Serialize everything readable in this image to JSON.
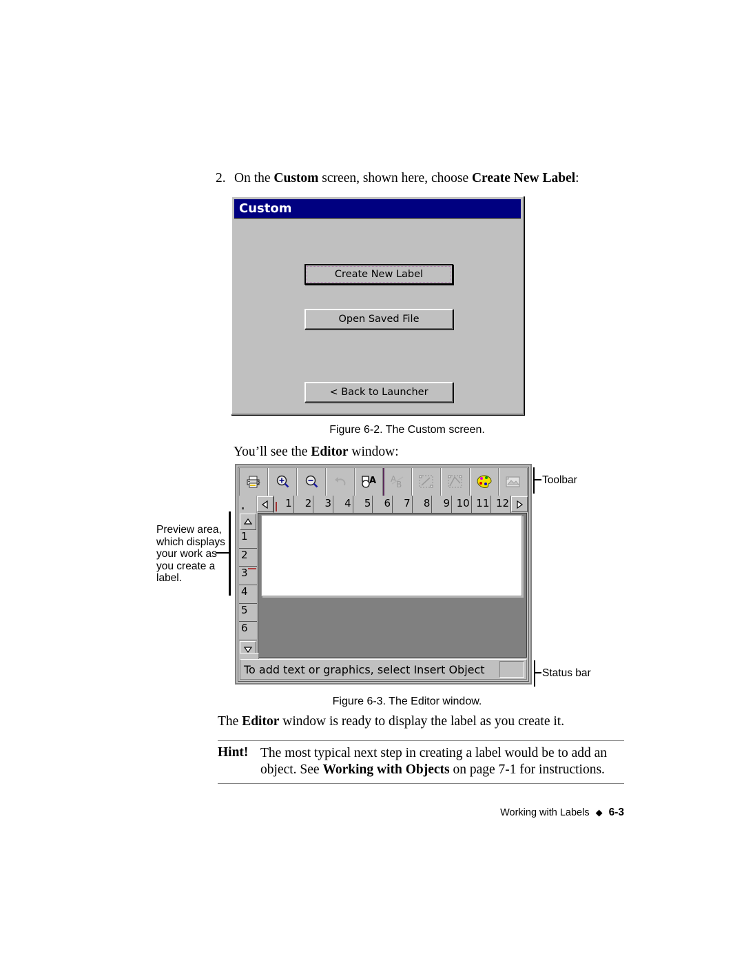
{
  "step": {
    "number": "2.",
    "before_bold1": "On the ",
    "bold1": "Custom",
    "middle": " screen, shown here, choose ",
    "bold2": "Create New Label",
    "after": ":"
  },
  "custom_dialog": {
    "title": "Custom",
    "buttons": [
      {
        "label": "Create New Label",
        "focused": true
      },
      {
        "label": "Open Saved File",
        "focused": false
      },
      {
        "label": "< Back to Launcher",
        "focused": false
      }
    ]
  },
  "figure_2_caption": "Figure 6-2. The Custom screen.",
  "lead_line": {
    "before": "You’ll see the ",
    "bold": "Editor",
    "after": " window:"
  },
  "editor_window": {
    "toolbar": [
      {
        "name": "print-icon",
        "label": "Print",
        "enabled": true
      },
      {
        "name": "zoom-in-icon",
        "label": "Zoom In",
        "enabled": true
      },
      {
        "name": "zoom-out-icon",
        "label": "Zoom Out",
        "enabled": true
      },
      {
        "name": "undo-icon",
        "label": "Undo",
        "enabled": false
      },
      {
        "name": "insert-object-icon",
        "label": "Insert Object",
        "enabled": true
      },
      {
        "name": "order-objects-icon",
        "label": "Order Objects",
        "enabled": false
      },
      {
        "name": "align-objects-icon",
        "label": "Align Objects",
        "enabled": false
      },
      {
        "name": "distribute-objects-icon",
        "label": "Distribute Objects",
        "enabled": false
      },
      {
        "name": "color-palette-icon",
        "label": "Color Palette",
        "enabled": true
      },
      {
        "name": "image-properties-icon",
        "label": "Image Properties",
        "enabled": false
      }
    ],
    "h_ruler": {
      "left_arrow": "◁",
      "right_arrow": "▷",
      "ticks": [
        "1",
        "2",
        "3",
        "4",
        "5",
        "6",
        "7",
        "8",
        "9",
        "10",
        "11",
        "12"
      ],
      "marker_at": "1"
    },
    "v_ruler": {
      "up_arrow": "△",
      "down_arrow": "▽",
      "ticks": [
        "1",
        "2",
        "3",
        "4",
        "5",
        "6"
      ],
      "marker_at": "3"
    },
    "status_text": "To add text or graphics, select Insert Object"
  },
  "callouts": {
    "toolbar": "Toolbar",
    "status_bar": "Status bar",
    "preview": "Preview area, which displays your work as you create a label."
  },
  "figure_3_caption": "Figure 6-3. The Editor window.",
  "closing": {
    "before": "The ",
    "bold": "Editor",
    "after": " window is ready to display the label as you create it."
  },
  "hint": {
    "label": "Hint!",
    "line1": "The most typical next step in creating a label would be to add an",
    "line2_before": "object. See ",
    "line2_bold": "Working with Objects",
    "line2_after": " on page 7-1 for instructions."
  },
  "footer": {
    "section": "Working with Labels",
    "separator": "◆",
    "page": "6-3"
  },
  "colors": {
    "titlebar": "#000080",
    "dialog_face": "#c0c0c0",
    "focus_ring": "#b07ab0",
    "workspace": "#808080",
    "paper": "#ffffff",
    "ruler_marker": "#a03030"
  }
}
